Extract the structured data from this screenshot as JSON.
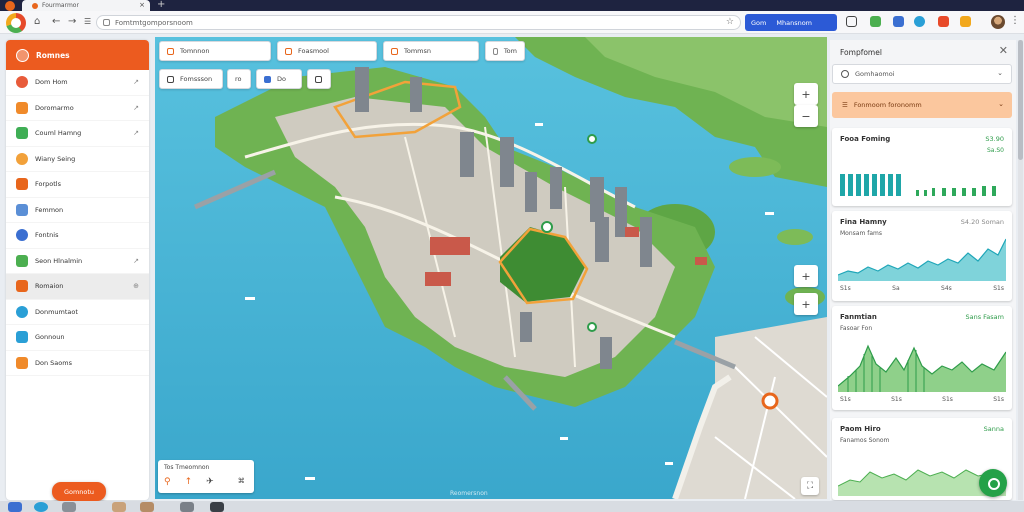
{
  "browser": {
    "tab_title": "Fourmarmor",
    "tab_close": "×",
    "new_tab": "+",
    "url": "Fomtmtgomporsnoom",
    "star": "☆",
    "search_label": "Gom",
    "search_value": "Mhansnom"
  },
  "sidebar": {
    "title": "Romnes",
    "items": [
      {
        "label": "Dom Hom",
        "icon": "location-pin-icon",
        "color": "#e85b3a",
        "arrow": "↗"
      },
      {
        "label": "Doromarmo",
        "icon": "layers-icon",
        "color": "#f08a2a",
        "arrow": "↗"
      },
      {
        "label": "Couml Hamng",
        "icon": "route-icon",
        "color": "#3fae55",
        "arrow": "↗"
      },
      {
        "label": "Wiany Seing",
        "icon": "eye-icon",
        "color": "#f2a13a",
        "arrow": ""
      },
      {
        "label": "Forpotls",
        "icon": "pin-icon",
        "color": "#e8661c",
        "arrow": ""
      },
      {
        "label": "Femmon",
        "icon": "building-icon",
        "color": "#5b8fd6",
        "arrow": ""
      },
      {
        "label": "Fontnis",
        "icon": "image-icon",
        "color": "#3b6fd1",
        "arrow": ""
      },
      {
        "label": "Seon Hlnalmin",
        "icon": "leaf-icon",
        "color": "#4caf50",
        "arrow": "↗"
      },
      {
        "label": "Romaion",
        "icon": "compass-icon",
        "color": "#e8661c",
        "arrow": "⊕"
      },
      {
        "label": "Donmumtaot",
        "icon": "globe-icon",
        "color": "#2a9fd6",
        "arrow": ""
      },
      {
        "label": "Gonnoun",
        "icon": "water-icon",
        "color": "#2a9fd6",
        "arrow": ""
      },
      {
        "label": "Don Saoms",
        "icon": "sun-icon",
        "color": "#f08a2a",
        "arrow": ""
      }
    ],
    "fab_label": "Gomnotu"
  },
  "map": {
    "chips_row1": [
      {
        "label": "Tomnnon"
      },
      {
        "label": "Foasmool"
      },
      {
        "label": "Tommsn"
      },
      {
        "label": "Tom"
      }
    ],
    "chips_row2": [
      {
        "label": "Fomssson",
        "icon": "share-icon"
      },
      {
        "label": "ro",
        "icon": "layers-icon"
      },
      {
        "label": "Do",
        "icon": "building-icon"
      },
      {
        "label": "",
        "icon": "square-icon"
      }
    ],
    "legend_title": "Tos  Tmeomnon",
    "bottom_caption": "Reomersnon",
    "zoom_in": "+",
    "zoom_out": "−",
    "colors": {
      "water": "#4eb7d6",
      "land": "#6fb352",
      "road": "#e8e2d4",
      "route": "#f2a23a"
    }
  },
  "panel": {
    "title": "Fompfomel",
    "close": "✕",
    "search_value": "Gomhaomoi",
    "filter_label": "Fonmoom foronomm",
    "cards": [
      {
        "title": "Fooa Foming",
        "sub": "",
        "value": "S3.90",
        "value2": "Sa.S0",
        "ticks": []
      },
      {
        "title": "Fina Hamny",
        "sub": "Monsam fams",
        "value": "S4.20 Soman",
        "value2": "",
        "ticks": [
          "S1s",
          "Sa",
          "S4s",
          "S1s"
        ]
      },
      {
        "title": "Fanmtian",
        "sub": "Fasoar Fon",
        "value": "Sans Fasam",
        "value2": "",
        "ticks": [
          "S1s",
          "S1s",
          "S1s",
          "S1s"
        ]
      },
      {
        "title": "Paom Hiro",
        "sub": "Fanamos Sonom",
        "value": "Sanna",
        "value2": "",
        "ticks": []
      }
    ]
  }
}
